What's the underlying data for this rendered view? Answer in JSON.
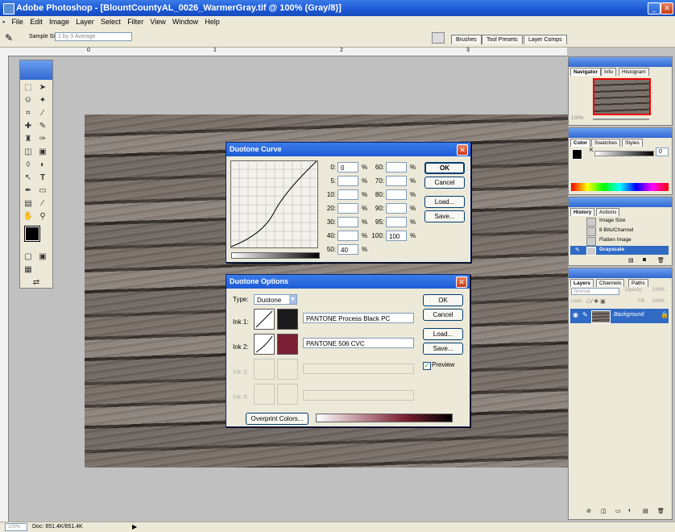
{
  "window": {
    "title": "Adobe Photoshop - [BlountCountyAL_0026_WarmerGray.tif @ 100% (Gray/8)]"
  },
  "menu": [
    "File",
    "Edit",
    "Image",
    "Layer",
    "Select",
    "Filter",
    "View",
    "Window",
    "Help"
  ],
  "options": {
    "sample_label": "Sample Size:",
    "sample_value": "1 by 3 Average"
  },
  "palette_tabs": [
    "Brushes",
    "Tool Presets",
    "Layer Comps"
  ],
  "ruler_ticks": [
    "0",
    "1",
    "2",
    "3",
    "4"
  ],
  "duotone_curve": {
    "title": "Duotone Curve",
    "rows": [
      {
        "l1": "0:",
        "v1": "0",
        "l2": "60:",
        "v2": ""
      },
      {
        "l1": "5:",
        "v1": "",
        "l2": "70:",
        "v2": ""
      },
      {
        "l1": "10:",
        "v1": "",
        "l2": "80:",
        "v2": ""
      },
      {
        "l1": "20:",
        "v1": "",
        "l2": "90:",
        "v2": ""
      },
      {
        "l1": "30:",
        "v1": "",
        "l2": "95:",
        "v2": ""
      },
      {
        "l1": "40:",
        "v1": "",
        "l2": "100:",
        "v2": "100"
      },
      {
        "l1": "50:",
        "v1": "40",
        "l2": "",
        "v2": ""
      }
    ],
    "pct": "%",
    "buttons": {
      "ok": "OK",
      "cancel": "Cancel",
      "load": "Load...",
      "save": "Save..."
    }
  },
  "duotone_options": {
    "title": "Duotone Options",
    "type_label": "Type:",
    "type_value": "Duotone",
    "inks": [
      {
        "label": "Ink 1:",
        "name": "PANTONE Process Black PC",
        "color": "#1a1a1a"
      },
      {
        "label": "Ink 2:",
        "name": "PANTONE 506 CVC",
        "color": "#7a1f33"
      },
      {
        "label": "Ink 3:",
        "name": "",
        "color": ""
      },
      {
        "label": "Ink 4:",
        "name": "",
        "color": ""
      }
    ],
    "buttons": {
      "ok": "OK",
      "cancel": "Cancel",
      "load": "Load...",
      "save": "Save..."
    },
    "preview_label": "Preview",
    "overprint": "Overprint Colors..."
  },
  "navigator": {
    "tabs": [
      "Navigator",
      "Info",
      "Histogram"
    ],
    "zoom": "100%"
  },
  "color_panel": {
    "tabs": [
      "Color",
      "Swatches",
      "Styles"
    ],
    "k_label": "K",
    "k_value": "0"
  },
  "history": {
    "tabs": [
      "History",
      "Actions"
    ],
    "items": [
      "Image Size",
      "8 Bits/Channel",
      "Flatten Image",
      "Grayscale"
    ]
  },
  "layers": {
    "tabs": [
      "Layers",
      "Channels",
      "Paths"
    ],
    "blend": "Normal",
    "opacity_label": "Opacity:",
    "opacity": "100%",
    "lock_label": "Lock:",
    "fill_label": "Fill:",
    "fill": "100%",
    "layer_name": "Background"
  },
  "status": {
    "zoom": "100%",
    "doc": "Doc: 651.4K/651.4K"
  }
}
